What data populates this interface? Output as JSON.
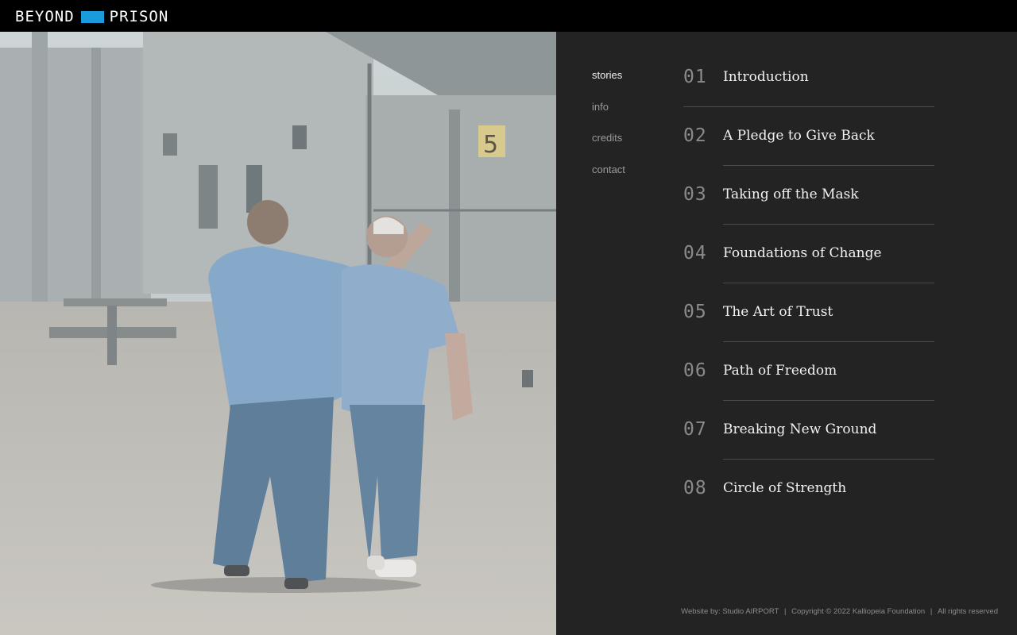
{
  "brand": {
    "left_word": "BEYOND",
    "right_word": "PRISON",
    "accent_color": "#1a9bdc"
  },
  "photo": {
    "description_icon": "photo-two-men-walking-prison-yard",
    "sign_number": "5"
  },
  "nav": [
    {
      "label": "stories",
      "active": true
    },
    {
      "label": "info",
      "active": false
    },
    {
      "label": "credits",
      "active": false
    },
    {
      "label": "contact",
      "active": false
    }
  ],
  "stories": [
    {
      "number": "01",
      "title": "Introduction"
    },
    {
      "number": "02",
      "title": "A Pledge to Give Back"
    },
    {
      "number": "03",
      "title": "Taking off the Mask"
    },
    {
      "number": "04",
      "title": "Foundations of Change"
    },
    {
      "number": "05",
      "title": "The Art of Trust"
    },
    {
      "number": "06",
      "title": "Path of Freedom"
    },
    {
      "number": "07",
      "title": "Breaking New Ground"
    },
    {
      "number": "08",
      "title": "Circle of Strength"
    }
  ],
  "footer": {
    "website": "Website by: Studio AIRPORT",
    "separator": "|",
    "copyright": "Copyright © 2022 Kalliopeia Foundation",
    "rights": "All rights reserved"
  }
}
